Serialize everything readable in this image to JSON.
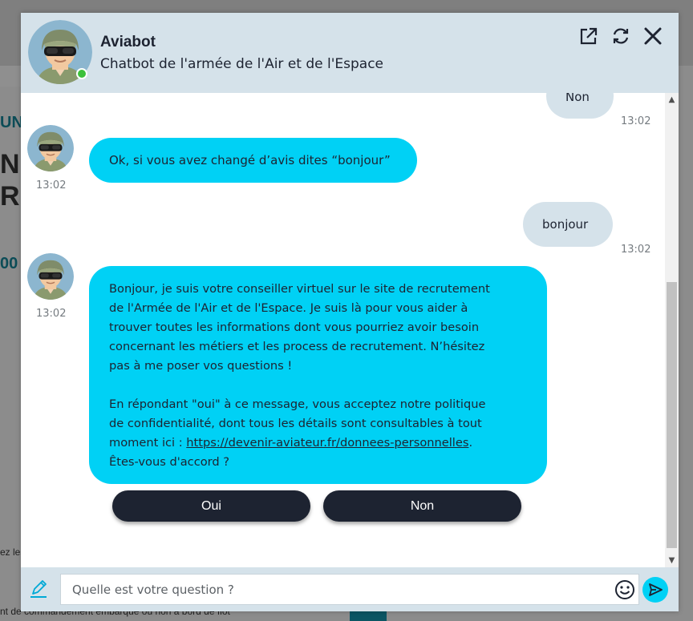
{
  "background": {
    "fragments": [
      "UN",
      "NU",
      "RI",
      "00"
    ],
    "small_texts": [
      "ez les",
      "nt de commandement embarqué ou non à bord de flot"
    ]
  },
  "header": {
    "bot_name": "Aviabot",
    "bot_subtitle": "Chatbot de l'armée de l'Air et de l'Espace",
    "icons": [
      "external-link-icon",
      "refresh-icon",
      "close-icon"
    ],
    "status": "online"
  },
  "messages": [
    {
      "sender": "user",
      "text": "Non",
      "time": "13:02"
    },
    {
      "sender": "bot",
      "text": "Ok, si vous avez changé d’avis dites “bonjour”",
      "time": "13:02"
    },
    {
      "sender": "user",
      "text": "bonjour",
      "time": "13:02"
    },
    {
      "sender": "bot",
      "time": "13:02",
      "lines": [
        "Bonjour, je suis votre conseiller virtuel sur le site de recrutement",
        "de l'Armée de l'Air et de l'Espace. Je suis là pour vous aider à",
        "trouver toutes les informations dont vous pourriez avoir besoin",
        "concernant les métiers et les process de recrutement. N’hésitez",
        "pas à me poser vos questions !",
        "En répondant \"oui\" à ce message, vous acceptez notre politique",
        "de confidentialité, dont tous les détails sont consultables à tout",
        "moment ici : ",
        "Êtes-vous d'accord ?"
      ],
      "link": "https://devenir-aviateur.fr/donnees-personnelles",
      "link_suffix": "."
    }
  ],
  "quick_replies": [
    "Oui",
    "Non"
  ],
  "input": {
    "placeholder": "Quelle est votre question ?",
    "value": ""
  },
  "colors": {
    "header_bg": "#d5e2ea",
    "bot_bubble": "#00d1f5",
    "user_bubble": "#d5e2ea",
    "dark_button": "#1d2331",
    "online": "#3cc13b"
  }
}
